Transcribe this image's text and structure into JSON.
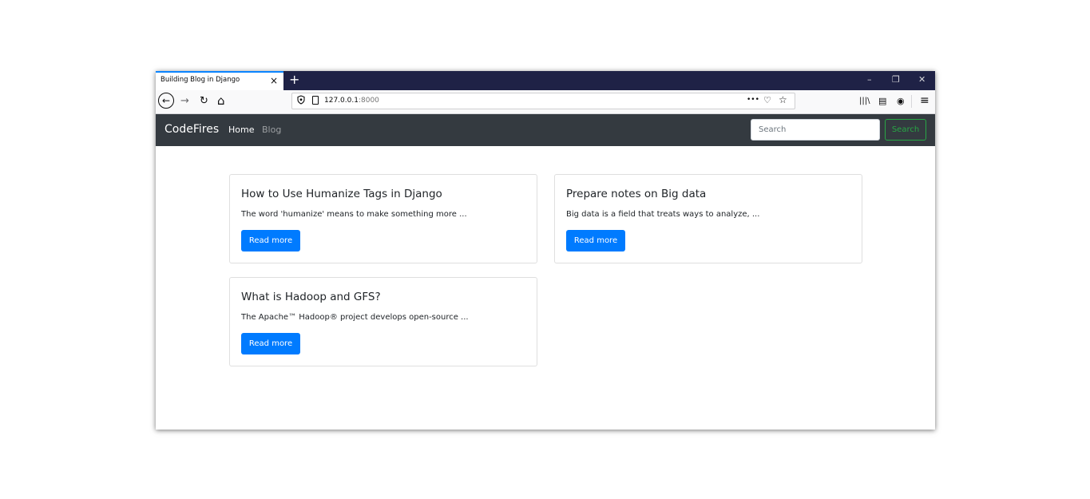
{
  "browser": {
    "tab_title": "Building Blog in Django",
    "tab_close": "×",
    "new_tab": "+",
    "window_controls": {
      "minimize": "–",
      "restore": "❐",
      "close": "✕"
    },
    "nav": {
      "back": "←",
      "forward": "→",
      "reload": "↻",
      "home": "⌂"
    },
    "url_host": "127.0.0.1",
    "url_port": ":8000",
    "page_actions": "•••",
    "pocket": "♡",
    "bookmark": "☆",
    "toolbar_right": {
      "library": "|||\\",
      "sidebar": "▤",
      "account": "◉",
      "menu": "≡"
    }
  },
  "site": {
    "brand": "CodeFires",
    "nav": {
      "home": "Home",
      "blog": "Blog"
    },
    "search": {
      "placeholder": "Search",
      "button": "Search"
    }
  },
  "posts": [
    {
      "title": "How to Use Humanize Tags in Django",
      "excerpt": "The word 'humanize' means to make something more ...",
      "button": "Read more"
    },
    {
      "title": "Prepare notes on Big data",
      "excerpt": "Big data is a field that treats ways to analyze, ...",
      "button": "Read more"
    },
    {
      "title": "What is Hadoop and GFS?",
      "excerpt": "The Apache™ Hadoop® project develops open-source ...",
      "button": "Read more"
    }
  ],
  "colors": {
    "titlebar": "#1f2246",
    "navbar": "#343a40",
    "primary": "#007bff",
    "success": "#28a745"
  }
}
